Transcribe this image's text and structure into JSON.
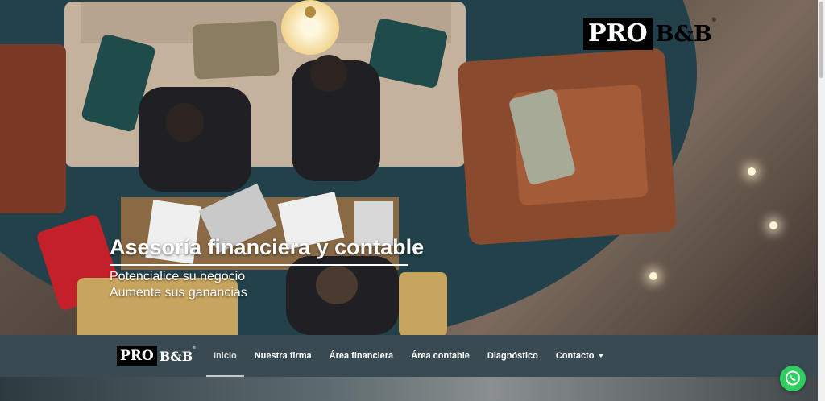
{
  "hero": {
    "logo": {
      "pro": "PRO",
      "bb": "B&B",
      "reg": "®"
    },
    "title": "Asesoría financiera y contable",
    "subtitle_1": "Potencialice su negocio",
    "subtitle_2": "Aumente sus ganancias"
  },
  "navbar": {
    "logo": {
      "pro": "PRO",
      "bb": "B&B",
      "reg": "®"
    },
    "items": [
      {
        "label": "Inicio"
      },
      {
        "label": "Nuestra firma"
      },
      {
        "label": "Área financiera"
      },
      {
        "label": "Área contable"
      },
      {
        "label": "Diagnóstico"
      },
      {
        "label": "Contacto"
      }
    ]
  },
  "icons": {
    "whatsapp": "whatsapp-icon",
    "dropdown": "caret-down-icon"
  },
  "colors": {
    "navbar": "#394a52",
    "whatsapp": "#2fcf5f",
    "logo_bg": "#000000"
  }
}
